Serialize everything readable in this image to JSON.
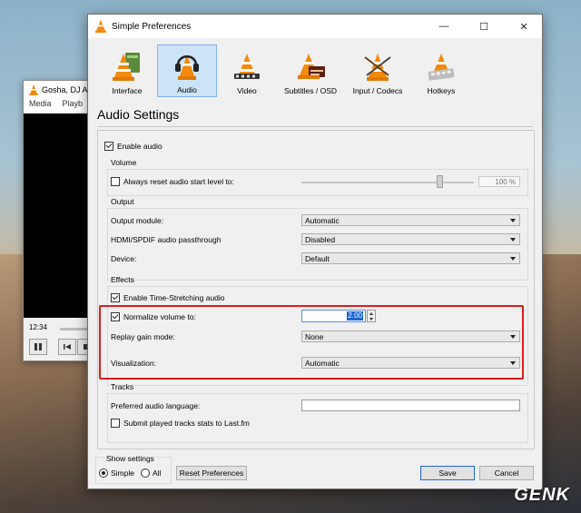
{
  "background_player": {
    "title": "Gosha, DJ A",
    "menu": [
      "Media",
      "Playb"
    ],
    "time": "12:34"
  },
  "window": {
    "title": "Simple Preferences",
    "minimize_glyph": "—",
    "maximize_glyph": "☐",
    "close_glyph": "✕"
  },
  "toolbar": {
    "items": [
      {
        "label": "Interface",
        "icon": "cone-interface-icon"
      },
      {
        "label": "Audio",
        "icon": "headphones-cone-icon",
        "selected": true
      },
      {
        "label": "Video",
        "icon": "cone-film-icon"
      },
      {
        "label": "Subtitles / OSD",
        "icon": "cone-subtitles-icon"
      },
      {
        "label": "Input / Codecs",
        "icon": "cone-codecs-icon"
      },
      {
        "label": "Hotkeys",
        "icon": "cone-keyboard-icon"
      }
    ]
  },
  "page": {
    "title": "Audio Settings",
    "enable_audio": {
      "label": "Enable audio",
      "checked": true
    },
    "volume": {
      "group_title": "Volume",
      "reset_label": "Always reset audio start level to:",
      "reset_checked": false,
      "level_percent": 100,
      "level_text": "100 %"
    },
    "output": {
      "group_title": "Output",
      "module_label": "Output module:",
      "module_value": "Automatic",
      "hdmi_label": "HDMI/SPDIF audio passthrough",
      "hdmi_value": "Disabled",
      "device_label": "Device:",
      "device_value": "Default"
    },
    "effects": {
      "group_title": "Effects",
      "time_stretch_label": "Enable Time-Stretching audio",
      "time_stretch_checked": true,
      "normalize_label": "Normalize volume to:",
      "normalize_checked": true,
      "normalize_value": "2.00",
      "replay_label": "Replay gain mode:",
      "replay_value": "None",
      "visual_label": "Visualization:",
      "visual_value": "Automatic"
    },
    "tracks": {
      "group_title": "Tracks",
      "lang_label": "Preferred audio language:",
      "lang_value": "",
      "stats_label": "Submit played tracks stats to Last.fm",
      "stats_checked": false
    }
  },
  "footer": {
    "show_settings_title": "Show settings",
    "simple_label": "Simple",
    "all_label": "All",
    "reset_label": "Reset Preferences",
    "save_label": "Save",
    "cancel_label": "Cancel"
  },
  "watermark": "GENK",
  "colors": {
    "highlight": "#e21b1b",
    "selection": "#cce4f7",
    "accent": "#1e66d0"
  }
}
